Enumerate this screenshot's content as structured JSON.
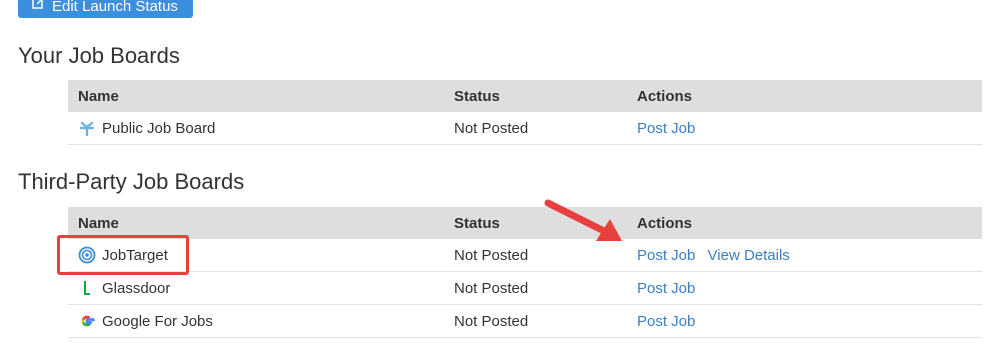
{
  "top_button": {
    "label": "Edit Launch Status",
    "icon": "edit-icon"
  },
  "your_boards": {
    "title": "Your Job Boards",
    "headers": [
      "Name",
      "Status",
      "Actions"
    ],
    "rows": [
      {
        "name": "Public Job Board",
        "icon": "public-board-icon",
        "status": "Not Posted",
        "actions": [
          "Post Job"
        ]
      }
    ]
  },
  "third_party_boards": {
    "title": "Third-Party Job Boards",
    "headers": [
      "Name",
      "Status",
      "Actions"
    ],
    "rows": [
      {
        "name": "JobTarget",
        "icon": "jobtarget-icon",
        "status": "Not Posted",
        "actions": [
          "Post Job",
          "View Details"
        ]
      },
      {
        "name": "Glassdoor",
        "icon": "glassdoor-icon",
        "status": "Not Posted",
        "actions": [
          "Post Job"
        ]
      },
      {
        "name": "Google For Jobs",
        "icon": "google-icon",
        "status": "Not Posted",
        "actions": [
          "Post Job"
        ]
      }
    ]
  },
  "colors": {
    "accent": "#3b8fdc",
    "link": "#3b7fc4",
    "header_bg": "#dedede",
    "annotation": "#e8403d"
  }
}
